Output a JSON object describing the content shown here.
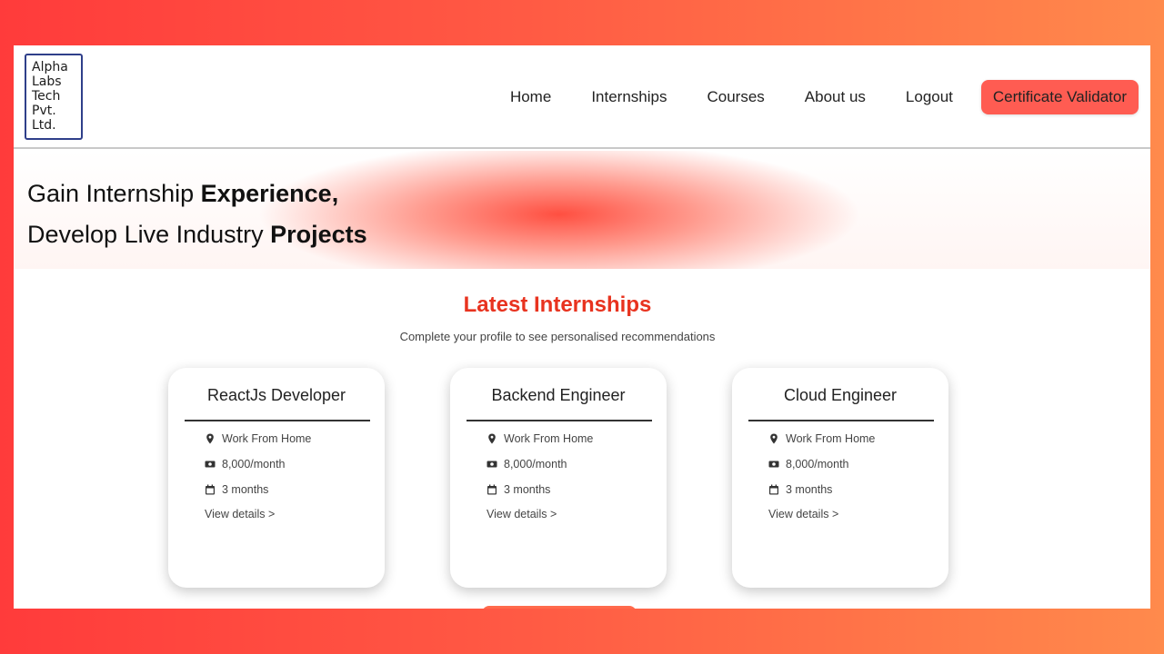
{
  "logo": {
    "lines": [
      "Alpha",
      "Labs",
      "Tech",
      "Pvt.",
      "Ltd."
    ]
  },
  "nav": {
    "links": [
      "Home",
      "Internships",
      "Courses",
      "About us",
      "Logout"
    ],
    "cta_label": "Certificate Validator"
  },
  "hero": {
    "line1_prefix": "Gain Internship ",
    "line1_bold": "Experience,",
    "line2_prefix": "Develop Live Industry ",
    "line2_bold": "Projects"
  },
  "section": {
    "title": "Latest Internships",
    "subtitle": "Complete your profile to see personalised recommendations"
  },
  "cards": [
    {
      "title": "ReactJs Developer",
      "location": "Work From Home",
      "stipend": "8,000/month",
      "duration": "3 months",
      "link": "View details >"
    },
    {
      "title": "Backend Engineer",
      "location": "Work From Home",
      "stipend": "8,000/month",
      "duration": "3 months",
      "link": "View details >"
    },
    {
      "title": "Cloud Engineer",
      "location": "Work From Home",
      "stipend": "8,000/month",
      "duration": "3 months",
      "link": "View details >"
    }
  ],
  "colors": {
    "accent": "#e8331f",
    "cta_background": "#ff5c52",
    "frame_gradient_start": "#ff3b3b",
    "frame_gradient_end": "#ff8a4c"
  },
  "icons": {
    "location": "map-pin-icon",
    "stipend": "money-icon",
    "duration": "calendar-icon"
  }
}
